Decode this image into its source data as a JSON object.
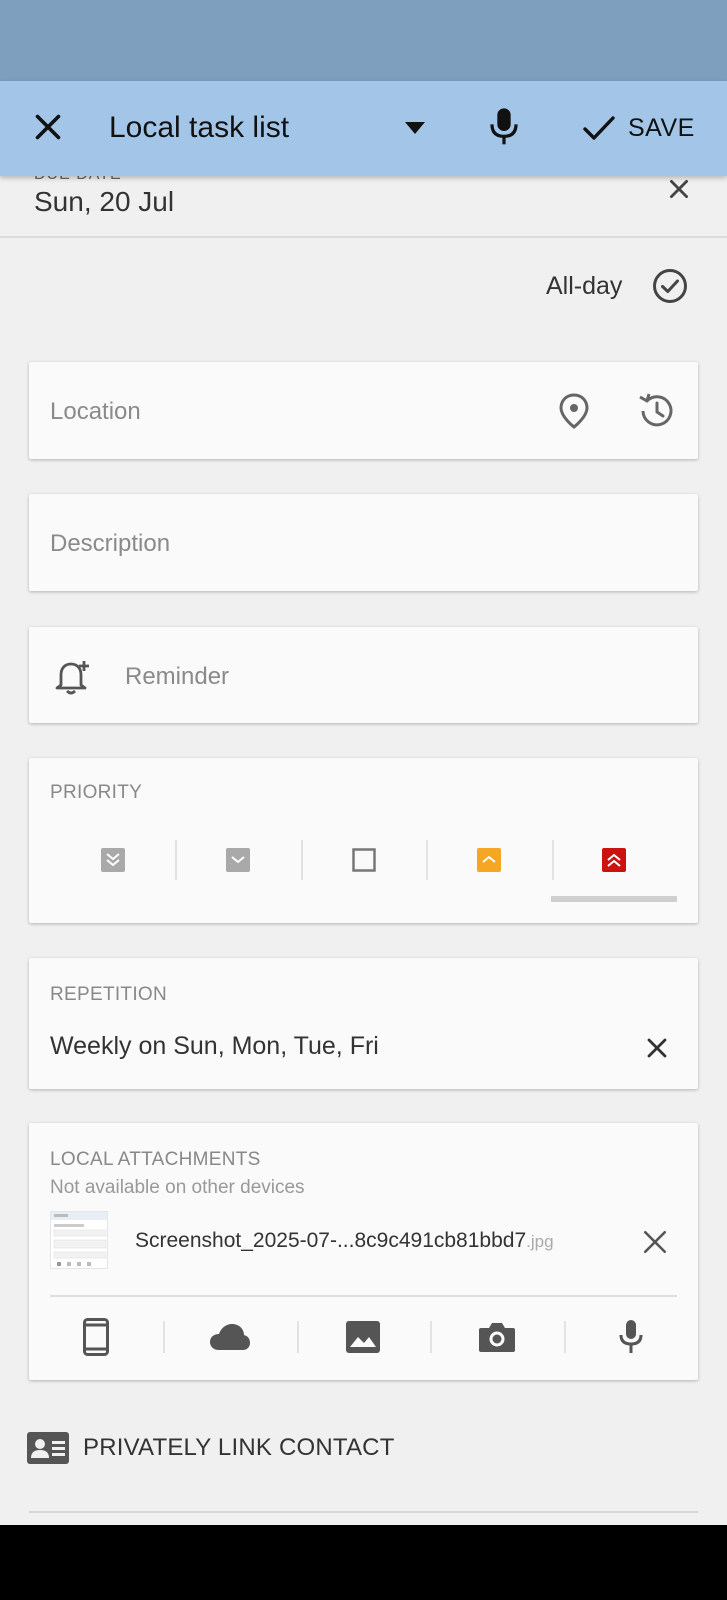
{
  "appbar": {
    "title": "Local task list",
    "save_label": "SAVE"
  },
  "due_date": {
    "label": "DUE DATE",
    "value": "Sun, 20 Jul"
  },
  "all_day": {
    "label": "All-day",
    "checked": true
  },
  "location": {
    "placeholder": "Location"
  },
  "description": {
    "placeholder": "Description"
  },
  "reminder": {
    "placeholder": "Reminder"
  },
  "priority": {
    "label": "PRIORITY",
    "options": [
      "lowest",
      "low",
      "none",
      "high",
      "highest"
    ],
    "selected_index": 4,
    "colors": {
      "lowest": "#a9a9a9",
      "low": "#a9a9a9",
      "high": "#f5a623",
      "highest": "#cc1111"
    }
  },
  "repetition": {
    "label": "REPETITION",
    "value": "Weekly on Sun, Mon, Tue, Fri"
  },
  "attachments": {
    "label": "LOCAL ATTACHMENTS",
    "subtitle": "Not available on other devices",
    "items": [
      {
        "name": "Screenshot_2025-07-...8c9c491cb81bbd7",
        "ext": ".jpg"
      }
    ],
    "sources": [
      "phone-icon",
      "cloud-icon",
      "image-icon",
      "camera-icon",
      "mic-icon"
    ]
  },
  "contact": {
    "label": "PRIVATELY LINK CONTACT"
  },
  "colors": {
    "status_bar": "#7f9fbf",
    "appbar": "#a3c6e8",
    "background": "#f0f0f0"
  }
}
